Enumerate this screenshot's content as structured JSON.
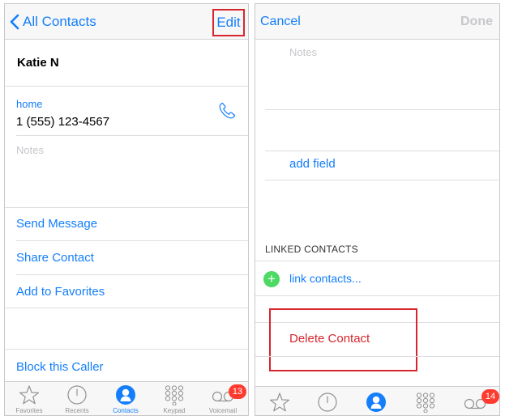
{
  "left_screen": {
    "back_label": "All Contacts",
    "edit_label": "Edit",
    "contact_name": "Katie N",
    "phone_label": "home",
    "phone_number": "1 (555) 123-4567",
    "notes_placeholder": "Notes",
    "actions": {
      "send_message": "Send Message",
      "share_contact": "Share Contact",
      "add_to_favorites": "Add to Favorites",
      "block_caller": "Block this Caller"
    },
    "tabbar": {
      "favorites": "Favorites",
      "recents": "Recents",
      "contacts": "Contacts",
      "keypad": "Keypad",
      "voicemail": "Voicemail",
      "voicemail_badge": "13"
    }
  },
  "right_screen": {
    "cancel_label": "Cancel",
    "done_label": "Done",
    "notes_placeholder": "Notes",
    "add_field_label": "add field",
    "linked_contacts_header": "LINKED CONTACTS",
    "link_contacts_label": "link contacts...",
    "delete_contact_label": "Delete Contact",
    "voicemail_badge": "14"
  },
  "colors": {
    "ios_blue": "#147efb",
    "highlight_red": "#d7262d",
    "badge_red": "#ff3b30",
    "add_green": "#4cd964"
  }
}
